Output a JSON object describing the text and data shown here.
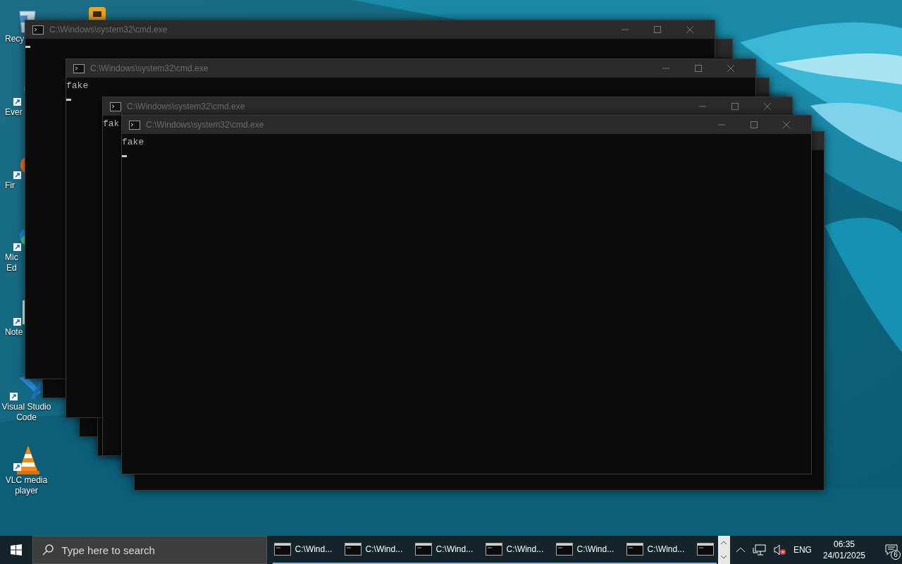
{
  "desktop_icons": [
    {
      "kind": "recycle-bin",
      "label": "Recy"
    },
    {
      "kind": "folder"
    },
    {
      "kind": "search-app",
      "label": "Ever"
    },
    {
      "kind": "browser-fox",
      "label": "Fir"
    },
    {
      "kind": "browser-wave",
      "label": "Mic\nEd"
    },
    {
      "kind": "notepad",
      "label": "Note"
    },
    {
      "kind": "code-editor",
      "label": "Visual Studio\nCode"
    },
    {
      "kind": "cone",
      "label": "VLC media\nplayer"
    }
  ],
  "windows": [
    {
      "kind": "frame"
    },
    {
      "kind": "frame"
    },
    {
      "kind": "frame"
    },
    {
      "kind": "frame"
    },
    {
      "kind": "titled",
      "title": "C:\\Windows\\system32\\cmd.exe",
      "cursor": true
    },
    {
      "kind": "titled",
      "title": "C:\\Windows\\system32\\cmd.exe",
      "lines": [
        "fake"
      ],
      "cursor": true
    },
    {
      "kind": "titled",
      "title": "C:\\Windows\\system32\\cmd.exe",
      "lines": [
        "fak"
      ]
    },
    {
      "kind": "titled",
      "title": "C:\\Windows\\system32\\cmd.exe",
      "lines": [
        "fake"
      ],
      "cursor": true
    }
  ],
  "taskbar": {
    "search": {
      "placeholder": "Type here to search"
    },
    "tasks": [
      {
        "kind": "labelled",
        "label": "C:\\Wind..."
      },
      {
        "kind": "labelled",
        "label": "C:\\Wind..."
      },
      {
        "kind": "labelled",
        "label": "C:\\Wind..."
      },
      {
        "kind": "labelled",
        "label": "C:\\Wind..."
      },
      {
        "kind": "labelled",
        "label": "C:\\Wind..."
      },
      {
        "kind": "labelled",
        "label": "C:\\Wind..."
      },
      {
        "kind": "icon-only"
      }
    ],
    "language": "ENG",
    "time": "06:35",
    "date": "24/01/2025",
    "notifications": "6"
  }
}
